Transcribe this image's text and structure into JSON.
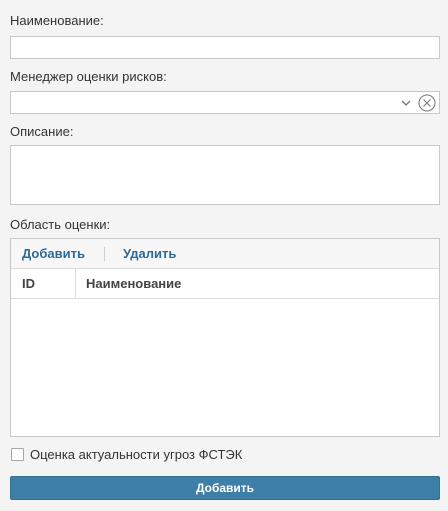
{
  "form": {
    "name_label": "Наименование:",
    "name_value": "",
    "manager_label": "Менеджер оценки рисков:",
    "manager_value": "",
    "description_label": "Описание:",
    "description_value": "",
    "scope_label": "Область оценки:",
    "scope_grid": {
      "toolbar": {
        "add_label": "Добавить",
        "delete_label": "Удалить"
      },
      "columns": [
        "ID",
        "Наименование"
      ],
      "rows": []
    },
    "fstek_label": "Оценка актуальности угроз ФСТЭК",
    "fstek_checked": false,
    "submit_label": "Добавить"
  },
  "colors": {
    "accent": "#3e7fa8",
    "link": "#2d6a9a",
    "background": "#f4f4f4"
  },
  "icons": {
    "dropdown": "chevron-down-icon",
    "clear": "clear-circle-icon"
  }
}
